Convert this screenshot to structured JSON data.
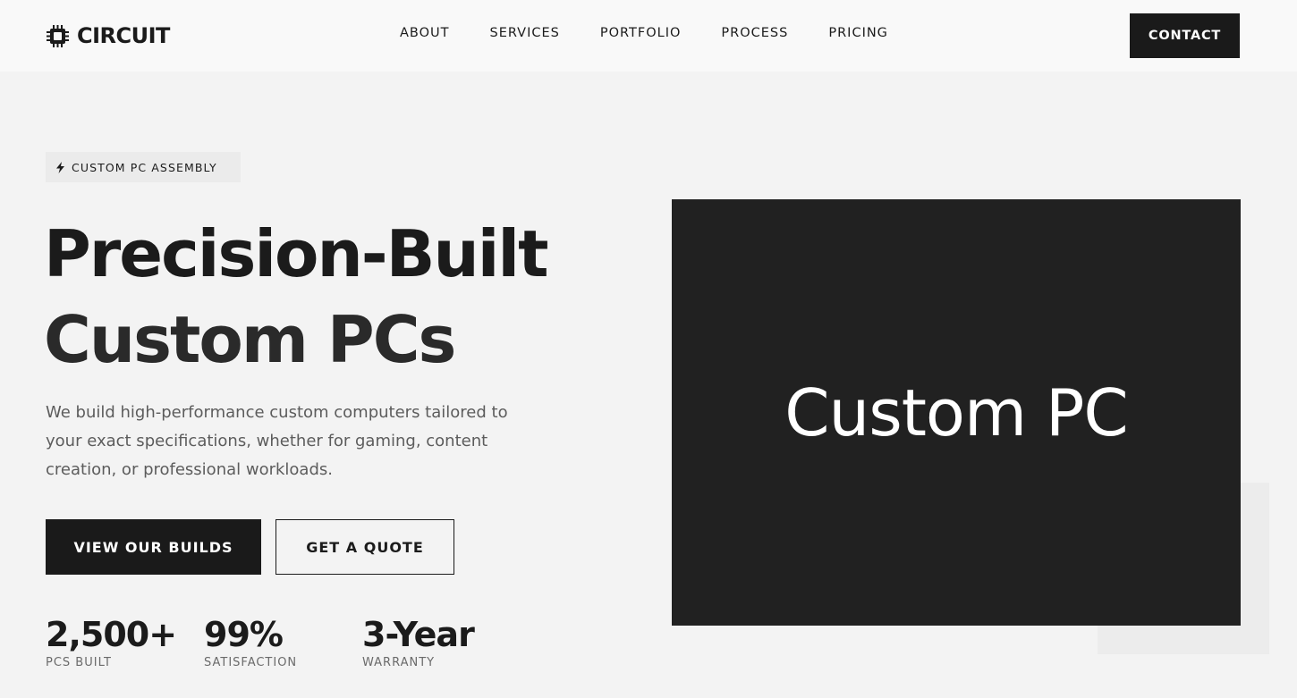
{
  "brand": {
    "name": "CIRCUIT",
    "icon": "chip-icon"
  },
  "nav": {
    "links": [
      "ABOUT",
      "SERVICES",
      "PORTFOLIO",
      "PROCESS",
      "PRICING"
    ],
    "contact_label": "CONTACT"
  },
  "hero": {
    "badge_icon": "bolt-icon",
    "badge": "CUSTOM PC ASSEMBLY",
    "headline_line1": "Precision-Built",
    "headline_line2": "Custom PCs",
    "subtitle": "We build high-performance custom computers tailored to your exact specifications, whether for gaming, content creation, or professional workloads.",
    "primary_cta": "VIEW OUR BUILDS",
    "secondary_cta": "GET A QUOTE",
    "image_label": "Custom PC"
  },
  "stats": [
    {
      "value": "2,500+",
      "label": "PCS BUILT"
    },
    {
      "value": "99%",
      "label": "SATISFACTION"
    },
    {
      "value": "3-Year",
      "label": "WARRANTY"
    }
  ],
  "colors": {
    "dark": "#1a1a1a",
    "background": "#f3f3f3",
    "image_bg": "#212121"
  }
}
